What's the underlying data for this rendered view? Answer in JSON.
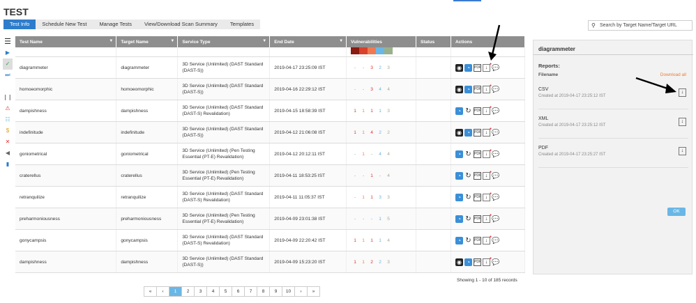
{
  "title": "TEST",
  "tabs": [
    "Test Info",
    "Schedule New Test",
    "Manage Tests",
    "View/Download Scan Summary",
    "Templates"
  ],
  "search_placeholder": "Search by Target Name/Target URL",
  "columns": [
    "Test Name",
    "Target Name",
    "Service Type",
    "End Date",
    "Vulnerabilities",
    "Status",
    "Actions"
  ],
  "severity_colors": [
    "#8b1a10",
    "#d9412b",
    "#f07a50",
    "#6ab7e6",
    "#9ab08a"
  ],
  "rows": [
    {
      "name": "diagrammeter",
      "target": "diagrammeter",
      "service": "3D Service (Unlimited) (DAST Standard (DAST-S))",
      "date": "2019-04-17 23:25:09 IST",
      "v": [
        "-",
        "-",
        "3",
        "2",
        "3"
      ],
      "cam": true
    },
    {
      "name": "homoeomorphic",
      "target": "homoeomorphic",
      "service": "3D Service (Unlimited) (DAST Standard (DAST-S))",
      "date": "2019-04-16 22:29:12 IST",
      "v": [
        "-",
        "-",
        "3",
        "4",
        "4"
      ],
      "cam": true
    },
    {
      "name": "dampishness",
      "target": "dampishness",
      "service": "3D Service (Unlimited) (DAST Standard (DAST-S) Revalidation)",
      "date": "2019-04-15 18:58:39 IST",
      "v": [
        "1",
        "1",
        "1",
        "1",
        "3"
      ],
      "cam": false
    },
    {
      "name": "indefinitude",
      "target": "indefinitude",
      "service": "3D Service (Unlimited) (DAST Standard (DAST-S))",
      "date": "2019-04-12 21:06:08 IST",
      "v": [
        "1",
        "1",
        "4",
        "2",
        "2"
      ],
      "cam": true
    },
    {
      "name": "goniometrical",
      "target": "goniometrical",
      "service": "3D Service (Unlimited) (Pen Testing Essential (PT-E) Revalidation)",
      "date": "2019-04-12 20:12:11 IST",
      "v": [
        "-",
        "1",
        "-",
        "4",
        "4"
      ],
      "cam": false
    },
    {
      "name": "craterellus",
      "target": "craterellus",
      "service": "3D Service (Unlimited) (Pen Testing Essential (PT-E) Revalidation)",
      "date": "2019-04-11 18:53:25 IST",
      "v": [
        "-",
        "-",
        "1",
        "-",
        "4"
      ],
      "cam": false
    },
    {
      "name": "retranquilize",
      "target": "retranquilize",
      "service": "3D Service (Unlimited) (DAST Standard (DAST-S) Revalidation)",
      "date": "2019-04-11 11:05:37 IST",
      "v": [
        "-",
        "1",
        "1",
        "3",
        "3"
      ],
      "cam": false
    },
    {
      "name": "preharmoniousness",
      "target": "preharmoniousness",
      "service": "3D Service (Unlimited) (Pen Testing Essential (PT-E) Revalidation)",
      "date": "2019-04-09 23:01:38 IST",
      "v": [
        "-",
        "-",
        "-",
        "1",
        "5"
      ],
      "cam": false
    },
    {
      "name": "gonycampsis",
      "target": "gonycampsis",
      "service": "3D Service (Unlimited) (DAST Standard (DAST-S) Revalidation)",
      "date": "2019-04-09 22:20:42 IST",
      "v": [
        "1",
        "1",
        "1",
        "1",
        "4"
      ],
      "cam": false
    },
    {
      "name": "dampishness",
      "target": "dampishness",
      "service": "3D Service (Unlimited) (DAST Standard (DAST-S))",
      "date": "2019-04-09 15:23:20 IST",
      "v": [
        "1",
        "1",
        "2",
        "2",
        "3"
      ],
      "cam": true
    }
  ],
  "pager": [
    "«",
    "‹",
    "1",
    "2",
    "3",
    "4",
    "5",
    "6",
    "7",
    "8",
    "9",
    "10",
    "›",
    "»"
  ],
  "showing": "Showing 1 - 10 of 185 records",
  "panel": {
    "title": "diagrammeter",
    "reports": "Reports:",
    "filename": "Filename",
    "download_all": "Download all",
    "files": [
      {
        "name": "CSV",
        "created": "Created at 2019-04-17 23:25:12 IST"
      },
      {
        "name": "XML",
        "created": "Created at 2019-04-17 23:25:12 IST"
      },
      {
        "name": "PDF",
        "created": "Created at 2019-04-17 23:25:27 IST"
      }
    ],
    "ok": "OK"
  }
}
